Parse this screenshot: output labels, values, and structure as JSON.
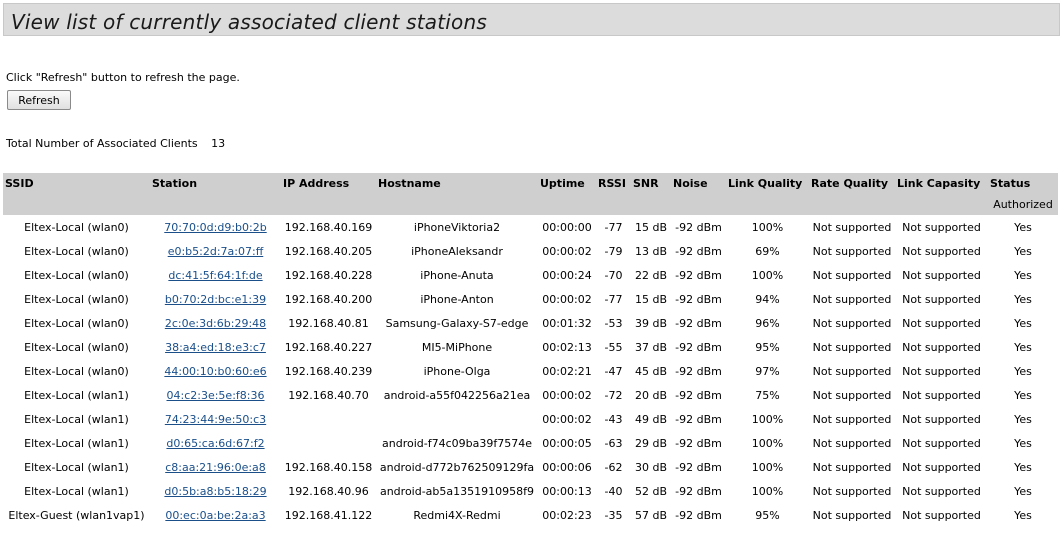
{
  "header": {
    "title": "View list of currently associated client stations"
  },
  "instructions": "Click \"Refresh\" button to refresh the page.",
  "refresh_label": "Refresh",
  "total": {
    "label": "Total Number of Associated Clients",
    "value": "13"
  },
  "table": {
    "columns": [
      "SSID",
      "Station",
      "IP Address",
      "Hostname",
      "Uptime",
      "RSSI",
      "SNR",
      "Noise",
      "Link Quality",
      "Rate Quality",
      "Link Capasity",
      "Status"
    ],
    "status_subheader": "Authorized",
    "rows": [
      {
        "ssid": "Eltex-Local (wlan0)",
        "station": "70:70:0d:d9:b0:2b",
        "ip": "192.168.40.169",
        "hostname": "iPhoneViktoria2",
        "uptime": "00:00:00",
        "rssi": "-77",
        "snr": "15 dB",
        "noise": "-92 dBm",
        "link_quality": "100%",
        "rate_quality": "Not supported",
        "link_capacity": "Not supported",
        "authorized": "Yes"
      },
      {
        "ssid": "Eltex-Local (wlan0)",
        "station": "e0:b5:2d:7a:07:ff",
        "ip": "192.168.40.205",
        "hostname": "iPhoneAleksandr",
        "uptime": "00:00:02",
        "rssi": "-79",
        "snr": "13 dB",
        "noise": "-92 dBm",
        "link_quality": "69%",
        "rate_quality": "Not supported",
        "link_capacity": "Not supported",
        "authorized": "Yes"
      },
      {
        "ssid": "Eltex-Local (wlan0)",
        "station": "dc:41:5f:64:1f:de",
        "ip": "192.168.40.228",
        "hostname": "iPhone-Anuta",
        "uptime": "00:00:24",
        "rssi": "-70",
        "snr": "22 dB",
        "noise": "-92 dBm",
        "link_quality": "100%",
        "rate_quality": "Not supported",
        "link_capacity": "Not supported",
        "authorized": "Yes"
      },
      {
        "ssid": "Eltex-Local (wlan0)",
        "station": "b0:70:2d:bc:e1:39",
        "ip": "192.168.40.200",
        "hostname": "iPhone-Anton",
        "uptime": "00:00:02",
        "rssi": "-77",
        "snr": "15 dB",
        "noise": "-92 dBm",
        "link_quality": "94%",
        "rate_quality": "Not supported",
        "link_capacity": "Not supported",
        "authorized": "Yes"
      },
      {
        "ssid": "Eltex-Local (wlan0)",
        "station": "2c:0e:3d:6b:29:48",
        "ip": "192.168.40.81",
        "hostname": "Samsung-Galaxy-S7-edge",
        "uptime": "00:01:32",
        "rssi": "-53",
        "snr": "39 dB",
        "noise": "-92 dBm",
        "link_quality": "96%",
        "rate_quality": "Not supported",
        "link_capacity": "Not supported",
        "authorized": "Yes"
      },
      {
        "ssid": "Eltex-Local (wlan0)",
        "station": "38:a4:ed:18:e3:c7",
        "ip": "192.168.40.227",
        "hostname": "MI5-MiPhone",
        "uptime": "00:02:13",
        "rssi": "-55",
        "snr": "37 dB",
        "noise": "-92 dBm",
        "link_quality": "95%",
        "rate_quality": "Not supported",
        "link_capacity": "Not supported",
        "authorized": "Yes"
      },
      {
        "ssid": "Eltex-Local (wlan0)",
        "station": "44:00:10:b0:60:e6",
        "ip": "192.168.40.239",
        "hostname": "iPhone-Olga",
        "uptime": "00:02:21",
        "rssi": "-47",
        "snr": "45 dB",
        "noise": "-92 dBm",
        "link_quality": "97%",
        "rate_quality": "Not supported",
        "link_capacity": "Not supported",
        "authorized": "Yes"
      },
      {
        "ssid": "Eltex-Local (wlan1)",
        "station": "04:c2:3e:5e:f8:36",
        "ip": "192.168.40.70",
        "hostname": "android-a55f042256a21ea",
        "uptime": "00:00:02",
        "rssi": "-72",
        "snr": "20 dB",
        "noise": "-92 dBm",
        "link_quality": "75%",
        "rate_quality": "Not supported",
        "link_capacity": "Not supported",
        "authorized": "Yes"
      },
      {
        "ssid": "Eltex-Local (wlan1)",
        "station": "74:23:44:9e:50:c3",
        "ip": "",
        "hostname": "",
        "uptime": "00:00:02",
        "rssi": "-43",
        "snr": "49 dB",
        "noise": "-92 dBm",
        "link_quality": "100%",
        "rate_quality": "Not supported",
        "link_capacity": "Not supported",
        "authorized": "Yes"
      },
      {
        "ssid": "Eltex-Local (wlan1)",
        "station": "d0:65:ca:6d:67:f2",
        "ip": "",
        "hostname": "android-f74c09ba39f7574e",
        "uptime": "00:00:05",
        "rssi": "-63",
        "snr": "29 dB",
        "noise": "-92 dBm",
        "link_quality": "100%",
        "rate_quality": "Not supported",
        "link_capacity": "Not supported",
        "authorized": "Yes"
      },
      {
        "ssid": "Eltex-Local (wlan1)",
        "station": "c8:aa:21:96:0e:a8",
        "ip": "192.168.40.158",
        "hostname": "android-d772b762509129fa",
        "uptime": "00:00:06",
        "rssi": "-62",
        "snr": "30 dB",
        "noise": "-92 dBm",
        "link_quality": "100%",
        "rate_quality": "Not supported",
        "link_capacity": "Not supported",
        "authorized": "Yes"
      },
      {
        "ssid": "Eltex-Local (wlan1)",
        "station": "d0:5b:a8:b5:18:29",
        "ip": "192.168.40.96",
        "hostname": "android-ab5a1351910958f9",
        "uptime": "00:00:13",
        "rssi": "-40",
        "snr": "52 dB",
        "noise": "-92 dBm",
        "link_quality": "100%",
        "rate_quality": "Not supported",
        "link_capacity": "Not supported",
        "authorized": "Yes"
      },
      {
        "ssid": "Eltex-Guest (wlan1vap1)",
        "station": "00:ec:0a:be:2a:a3",
        "ip": "192.168.41.122",
        "hostname": "Redmi4X-Redmi",
        "uptime": "00:02:23",
        "rssi": "-35",
        "snr": "57 dB",
        "noise": "-92 dBm",
        "link_quality": "95%",
        "rate_quality": "Not supported",
        "link_capacity": "Not supported",
        "authorized": "Yes"
      }
    ]
  }
}
